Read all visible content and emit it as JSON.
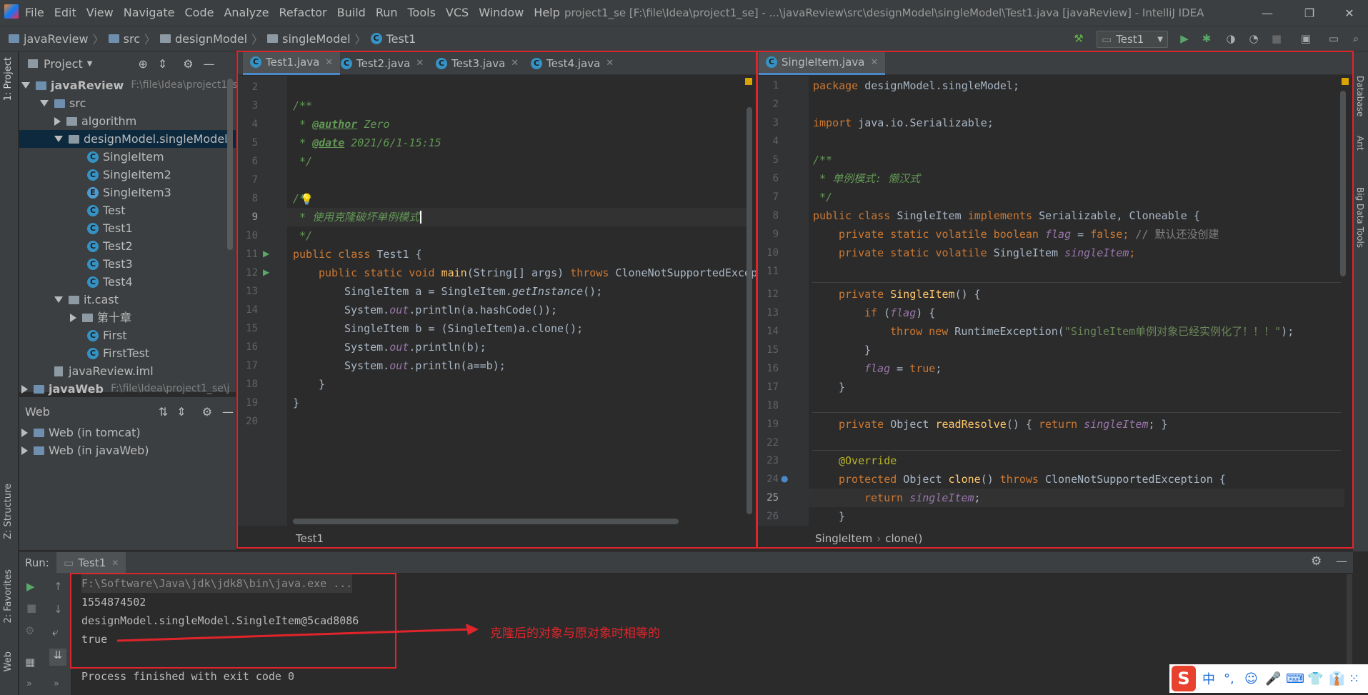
{
  "menu": [
    "File",
    "Edit",
    "View",
    "Navigate",
    "Code",
    "Analyze",
    "Refactor",
    "Build",
    "Run",
    "Tools",
    "VCS",
    "Window",
    "Help"
  ],
  "window_title": "project1_se [F:\\file\\Idea\\project1_se] - ...\\javaReview\\src\\designModel\\singleModel\\Test1.java [javaReview] - IntelliJ IDEA",
  "breadcrumb": [
    "javaReview",
    "src",
    "designModel",
    "singleModel",
    "Test1"
  ],
  "run_config": "Test1",
  "left_strip": {
    "project": "1: Project",
    "structure": "Z: Structure",
    "favorites": "2: Favorites",
    "web": "Web"
  },
  "right_strip": {
    "database": "Database",
    "ant": "Ant",
    "bigdata": "Big Data Tools"
  },
  "project_panel": {
    "title": "Project",
    "tree": [
      {
        "label": "javaReview",
        "path": "F:\\file\\Idea\\project1_s",
        "type": "module"
      },
      {
        "label": "src",
        "type": "folder"
      },
      {
        "label": "algorithm",
        "type": "package"
      },
      {
        "label": "designModel.singleModel",
        "type": "package"
      },
      {
        "label": "SingleItem",
        "type": "class"
      },
      {
        "label": "SingleItem2",
        "type": "class"
      },
      {
        "label": "SingleItem3",
        "type": "enum"
      },
      {
        "label": "Test",
        "type": "class"
      },
      {
        "label": "Test1",
        "type": "class"
      },
      {
        "label": "Test2",
        "type": "class"
      },
      {
        "label": "Test3",
        "type": "class"
      },
      {
        "label": "Test4",
        "type": "class"
      },
      {
        "label": "it.cast",
        "type": "package"
      },
      {
        "label": "第十章",
        "type": "package"
      },
      {
        "label": "First",
        "type": "class"
      },
      {
        "label": "FirstTest",
        "type": "class"
      },
      {
        "label": "javaReview.iml",
        "type": "file"
      },
      {
        "label": "javaWeb",
        "path": "F:\\file\\Idea\\project1_se\\j",
        "type": "module"
      }
    ]
  },
  "web_panel": {
    "title": "Web",
    "items": [
      "Web (in tomcat)",
      "Web (in javaWeb)"
    ]
  },
  "editor_left": {
    "tabs": [
      "Test1.java",
      "Test2.java",
      "Test3.java",
      "Test4.java"
    ],
    "line_numbers": [
      "2",
      "3",
      "4",
      "5",
      "6",
      "7",
      "8",
      "9",
      "10",
      "11",
      "12",
      "13",
      "14",
      "15",
      "16",
      "17",
      "18",
      "19",
      "20"
    ],
    "breadcrumb": "Test1",
    "code": {
      "l3": "/**",
      "l4a": " * ",
      "l4tag": "@author",
      "l4b": " Zero",
      "l5a": " * ",
      "l5tag": "@date",
      "l5b": " 2021/6/1-15:15",
      "l6": " */",
      "l8": "/**",
      "l9": " * 使用克隆破坏单例模式",
      "l10": " */",
      "l11kw": "public class",
      "l11b": " Test1 {",
      "l12kw": "public static void",
      "l12m": "main",
      "l12b": "(String[] args) ",
      "l12kw2": "throws",
      "l12c": " CloneNotSupportedExcep",
      "l13a": "SingleItem a = SingleItem.",
      "l13i": "getInstance",
      "l13b": "();",
      "l14a": "System.",
      "l14f": "out",
      "l14b": ".println(a.hashCode());",
      "l15": "SingleItem b = (SingleItem)a.clone();",
      "l16a": "System.",
      "l16f": "out",
      "l16b": ".println(b);",
      "l17a": "System.",
      "l17f": "out",
      "l17b": ".println(a==b);",
      "l18": "}",
      "l19": "}"
    }
  },
  "editor_right": {
    "tabs": [
      "SingleItem.java"
    ],
    "line_numbers": [
      "1",
      "2",
      "3",
      "4",
      "5",
      "6",
      "7",
      "8",
      "9",
      "10",
      "11",
      "12",
      "13",
      "14",
      "15",
      "16",
      "17",
      "18",
      "19",
      "22",
      "23",
      "24",
      "25",
      "26"
    ],
    "breadcrumb": [
      "SingleItem",
      "clone()"
    ],
    "code": {
      "r1kw": "package",
      "r1b": " designModel.singleModel;",
      "r3kw": "import",
      "r3b": " java.io.Serializable;",
      "r5": "/**",
      "r6": " * 单例模式: 懒汉式",
      "r7": " */",
      "r8kw": "public class",
      "r8b": " SingleItem ",
      "r8kw2": "implements",
      "r8c": " Serializable, Cloneable {",
      "r9kw": "private static volatile boolean",
      "r9f": " flag",
      "r9b": " = ",
      "r9kw2": "false",
      "r9c": ";",
      "r9cmt": " // 默认还没创建",
      "r10kw": "private static volatile",
      "r10b": " SingleItem ",
      "r10f": "singleItem",
      "r10c": ";",
      "r12kw": "private",
      "r12m": " SingleItem",
      "r12b": "() {",
      "r13kw": "if",
      "r13a": " (",
      "r13f": "flag",
      "r13b": ") {",
      "r14kw": "throw new",
      "r14a": " RuntimeException(",
      "r14s": "\"SingleItem单例对象已经实例化了！！！\"",
      "r14b": ");",
      "r15": "}",
      "r16f": "flag",
      "r16a": " = ",
      "r16kw": "true",
      "r16b": ";",
      "r17": "}",
      "r19kw": "private",
      "r19a": " Object ",
      "r19m": "readResolve",
      "r19b": "() { ",
      "r19kw2": "return",
      "r19f": " singleItem",
      "r19c": "; }",
      "r23": "@Override",
      "r24kw": "protected",
      "r24a": " Object ",
      "r24m": "clone",
      "r24b": "() ",
      "r24kw2": "throws",
      "r24c": " CloneNotSupportedException {",
      "r25kw": "return",
      "r25f": " singleItem",
      "r25b": ";",
      "r26": "}"
    }
  },
  "run_panel": {
    "label": "Run:",
    "tab": "Test1",
    "output": [
      "F:\\Software\\Java\\jdk\\jdk8\\bin\\java.exe ...",
      "1554874502",
      "designModel.singleModel.SingleItem@5cad8086",
      "true",
      "",
      "Process finished with exit code 0"
    ]
  },
  "annotation": {
    "text": "克隆后的对象与原对象时相等的",
    "color": "#e0242b"
  },
  "ime": {
    "lang": "中"
  },
  "colors": {
    "accent": "#4a88c7",
    "annotation": "#e0242b",
    "keyword": "#cc7832",
    "doc": "#629755"
  }
}
